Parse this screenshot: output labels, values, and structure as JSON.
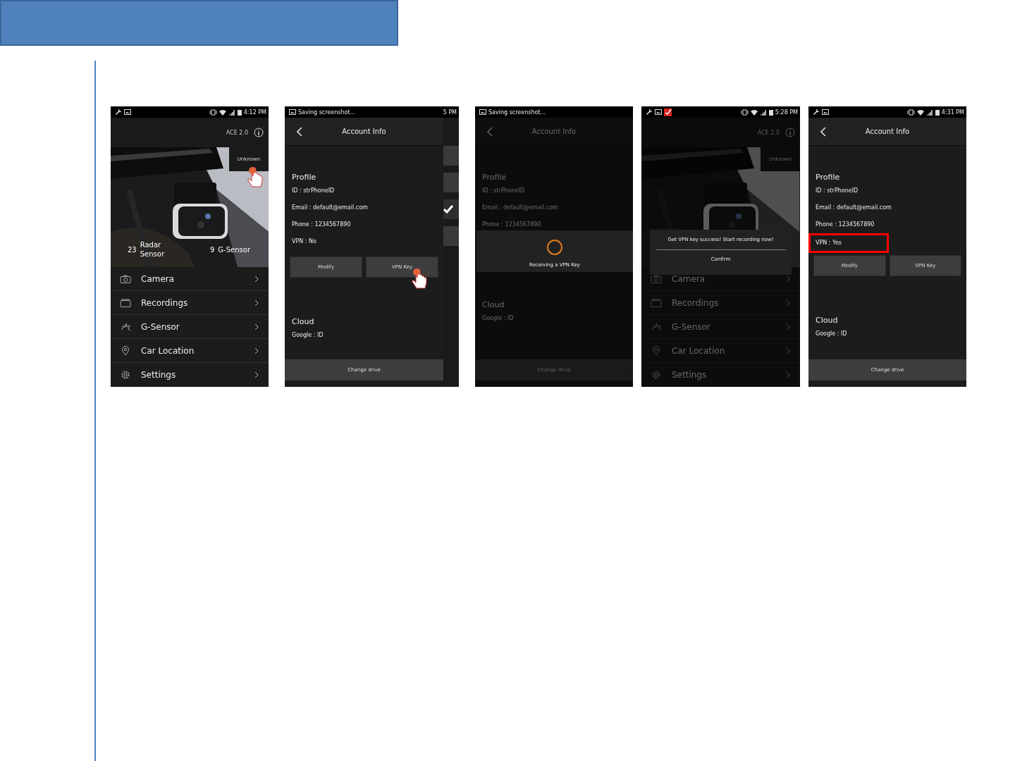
{
  "screens": [
    {
      "kind": "home",
      "dimmed": false,
      "status": {
        "time": "4:12 PM",
        "alert_icon": false
      },
      "model": "ACE 2.0",
      "badge": "Unknown",
      "badge_tapped": true,
      "stats": [
        {
          "value": "23",
          "label": "Radar Sensor"
        },
        {
          "value": "9",
          "label": "G-Sensor"
        }
      ],
      "menu": [
        "Camera",
        "Recordings",
        "G-Sensor",
        "Car Location",
        "Settings"
      ]
    },
    {
      "kind": "account",
      "dimmed": false,
      "side_strip": true,
      "status": {
        "notice": "Saving screenshot...",
        "time": "5 PM"
      },
      "title": "Account Info",
      "profile_heading": "Profile",
      "profile": [
        {
          "text": "ID : strPhoneID",
          "highlighted": false
        },
        {
          "text": "Email : default@email.com",
          "highlighted": false
        },
        {
          "text": "Phone : 1234567890",
          "highlighted": false
        },
        {
          "text": "VPN : No",
          "highlighted": false
        }
      ],
      "buttons": [
        {
          "label": "Modify",
          "tapped": false
        },
        {
          "label": "VPN Key",
          "tapped": true
        }
      ],
      "cloud_heading": "Cloud",
      "cloud": [
        "Google : ID"
      ],
      "drive_button": "Change drive"
    },
    {
      "kind": "account",
      "dimmed": true,
      "status": {
        "notice": "Saving screenshot..."
      },
      "title": "Account Info",
      "profile_heading": "Profile",
      "profile": [
        {
          "text": "ID : strPhoneID",
          "highlighted": false
        },
        {
          "text": "Email : default@email.com",
          "highlighted": false
        },
        {
          "text": "Phone : 1234567890",
          "highlighted": false
        }
      ],
      "cloud_heading": "Cloud",
      "cloud": [
        "Google : ID"
      ],
      "drive_button": "Change drive",
      "dialog": {
        "kind": "progress",
        "message": "Receiving a VPN Key"
      }
    },
    {
      "kind": "home",
      "dimmed": true,
      "status": {
        "time": "5:28 PM",
        "alert_icon": true
      },
      "model": "ACE 2.0",
      "badge": "Unknown",
      "menu": [
        "Camera",
        "Recordings",
        "G-Sensor",
        "Car Location",
        "Settings"
      ],
      "dialog": {
        "kind": "confirm",
        "message": "Get VPN key success! Start recording now!",
        "button": "Confirm"
      }
    },
    {
      "kind": "account",
      "dimmed": false,
      "status": {
        "time": "4:31 PM"
      },
      "title": "Account Info",
      "profile_heading": "Profile",
      "profile": [
        {
          "text": "ID : strPhoneID",
          "highlighted": false
        },
        {
          "text": "Email : default@email.com",
          "highlighted": false
        },
        {
          "text": "Phone : 1234567890",
          "highlighted": false
        },
        {
          "text": "VPN : Yes",
          "highlighted": true
        }
      ],
      "buttons": [
        {
          "label": "Modify",
          "tapped": false
        },
        {
          "label": "VPN Key",
          "tapped": false
        }
      ],
      "cloud_heading": "Cloud",
      "cloud": [
        "Google : ID"
      ],
      "drive_button": "Change drive"
    }
  ]
}
